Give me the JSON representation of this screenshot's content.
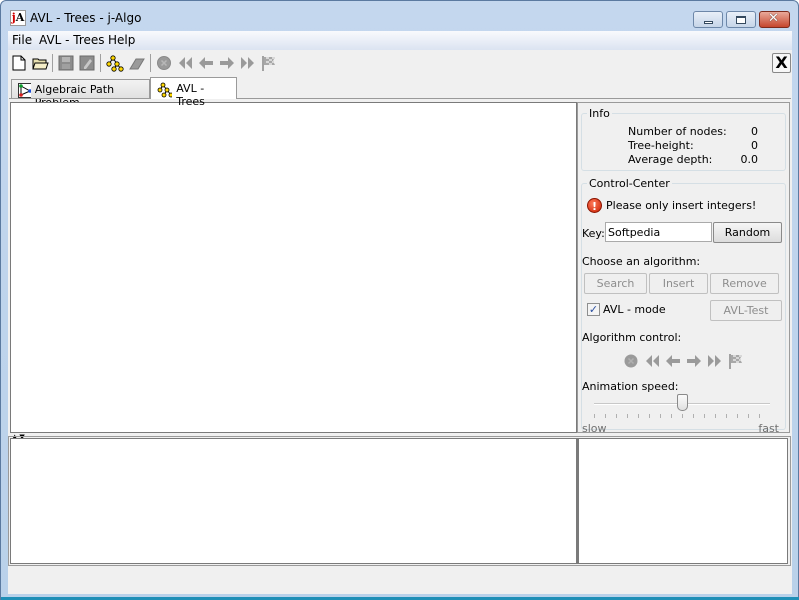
{
  "window": {
    "title": "AVL - Trees  -  j-Algo",
    "app_icon": "jA",
    "controls": {
      "minimize": "minimize-icon",
      "maximize": "maximize-icon",
      "close": "close-icon"
    }
  },
  "menubar": {
    "items": [
      {
        "label": "File"
      },
      {
        "label": "AVL - Trees"
      },
      {
        "label": "Help"
      }
    ]
  },
  "toolbar": {
    "icons": [
      "new-file-icon",
      "open-folder-icon",
      "save-icon",
      "save-as-icon",
      "tree-icon",
      "eraser-icon",
      "stop-icon",
      "rewind-icon",
      "step-back-icon",
      "step-forward-icon",
      "fast-forward-icon",
      "finish-flag-icon"
    ],
    "close_label": "X"
  },
  "tabs": [
    {
      "label": "Algebraic Path Problem",
      "icon": "graph-icon",
      "active": false
    },
    {
      "label": "AVL - Trees",
      "icon": "tree-icon",
      "active": true
    }
  ],
  "info": {
    "title": "Info",
    "rows": [
      {
        "label": "Number of nodes:",
        "value": "0"
      },
      {
        "label": "Tree-height:",
        "value": "0"
      },
      {
        "label": "Average depth:",
        "value": "0.0"
      }
    ]
  },
  "control_center": {
    "title": "Control-Center",
    "warning": "Please only insert integers!",
    "key_label": "Key:",
    "key_value": "Softpedia",
    "random_label": "Random",
    "choose_label": "Choose an algorithm:",
    "search_label": "Search",
    "insert_label": "Insert",
    "remove_label": "Remove",
    "avl_mode_label": "AVL - mode",
    "avl_mode_checked": true,
    "avl_test_label": "AVL-Test",
    "algorithm_control_label": "Algorithm control:",
    "animation_speed_label": "Animation speed:",
    "speed_fraction": 0.5,
    "slow_label": "slow",
    "fast_label": "fast"
  },
  "colors": {
    "title_bar": "#c4d7ee",
    "close_button": "#c5462d",
    "warning": "#c81e00"
  }
}
